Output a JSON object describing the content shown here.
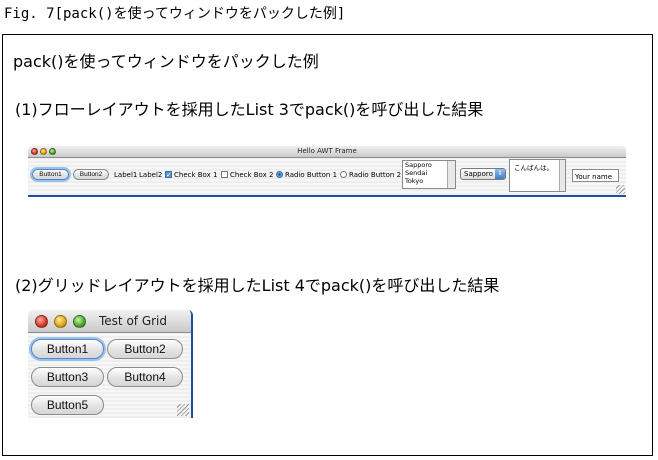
{
  "figure_caption": "Fig. 7[pack()を使ってウィンドウをパックした例]",
  "box_title": "pack()を使ってウィンドウをパックした例",
  "section1": {
    "caption": "(1)フローレイアウトを採用したList 3でpack()を呼び出した結果",
    "window": {
      "title": "Hello AWT Frame",
      "button1": "Button1",
      "button2": "Button2",
      "label1": "Label1",
      "label2": "Label2",
      "checkbox1": "Check Box 1",
      "checkbox1_checked": true,
      "checkbox2": "Check Box 2",
      "checkbox2_checked": false,
      "radio1": "Radio Button 1",
      "radio1_selected": true,
      "radio2": "Radio Button 2",
      "radio2_selected": false,
      "list_items": [
        "Sapporo",
        "Sendai",
        "Tokyo"
      ],
      "choice_value": "Sapporo",
      "textarea_value": "こんばんは。",
      "textfield_value": "Your name"
    }
  },
  "section2": {
    "caption": "(2)グリッドレイアウトを採用したList 4でpack()を呼び出した結果",
    "window": {
      "title": "Test of Grid",
      "buttons": [
        "Button1",
        "Button2",
        "Button3",
        "Button4",
        "Button5"
      ]
    }
  },
  "colors": {
    "desktop_blue": "#1f4f9a",
    "focus_ring": "#9bc1ea",
    "checkbox_on": "#5d93cf"
  }
}
